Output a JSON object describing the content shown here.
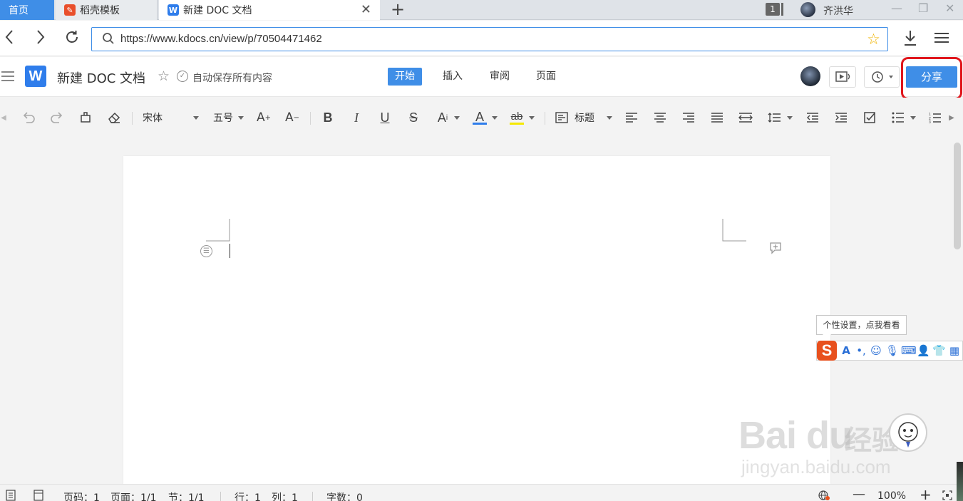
{
  "browser": {
    "tabs": [
      {
        "label": "首页",
        "active": false
      },
      {
        "label": "稻壳模板",
        "active": false
      },
      {
        "label": "新建 DOC 文档",
        "active": true
      }
    ],
    "tab_count": "1",
    "user_name": "齐洪华",
    "url": "https://www.kdocs.cn/view/p/70504471462"
  },
  "doc": {
    "title": "新建 DOC 文档",
    "save_status": "自动保存所有内容",
    "menu_tabs": [
      "开始",
      "插入",
      "审阅",
      "页面"
    ],
    "active_menu": "开始",
    "share_label": "分享"
  },
  "toolbar": {
    "font_name": "宋体",
    "font_size": "五号",
    "style_label": "标题",
    "font_color": "#2f7deb",
    "highlight_color": "#f5e800"
  },
  "ime": {
    "tooltip": "个性设置，点我看看",
    "logo": "S"
  },
  "statusbar": {
    "page_no": "页码：1",
    "pages": "页面：1/1",
    "section": "节：1/1",
    "row": "行：1",
    "col": "列：1",
    "word_count": "字数：0",
    "zoom": "100%"
  },
  "watermark": {
    "brand": "Bai du",
    "jingyan": "经验",
    "url": "jingyan.baidu.com"
  },
  "colors": {
    "accent": "#3f8ee7",
    "highlight_ring": "#e0161c"
  }
}
